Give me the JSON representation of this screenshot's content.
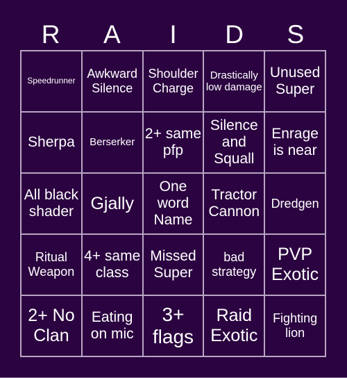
{
  "title": [
    "R",
    "A",
    "I",
    "D",
    "S"
  ],
  "cells": [
    {
      "text": "Speedrunner",
      "size": "s-xs"
    },
    {
      "text": "Awkward Silence",
      "size": "s-md"
    },
    {
      "text": "Shoulder Charge",
      "size": "s-md"
    },
    {
      "text": "Drastically low damage",
      "size": "s-sm"
    },
    {
      "text": "Unused Super",
      "size": "s-lg"
    },
    {
      "text": "Sherpa",
      "size": "s-lg"
    },
    {
      "text": "Berserker",
      "size": "s-sm"
    },
    {
      "text": "2+ same pfp",
      "size": "s-lg"
    },
    {
      "text": "Silence and Squall",
      "size": "s-lg"
    },
    {
      "text": "Enrage is near",
      "size": "s-lg"
    },
    {
      "text": "All black shader",
      "size": "s-lg"
    },
    {
      "text": "Gjally",
      "size": "s-xl"
    },
    {
      "text": "One word Name",
      "size": "s-lg"
    },
    {
      "text": "Tractor Cannon",
      "size": "s-lg"
    },
    {
      "text": "Dredgen",
      "size": "s-md"
    },
    {
      "text": "Ritual Weapon",
      "size": "s-md"
    },
    {
      "text": "4+ same class",
      "size": "s-lg"
    },
    {
      "text": "Missed Super",
      "size": "s-lg"
    },
    {
      "text": "bad strategy",
      "size": "s-md"
    },
    {
      "text": "PVP Exotic",
      "size": "s-xl"
    },
    {
      "text": "2+ No Clan",
      "size": "s-xl"
    },
    {
      "text": "Eating on mic",
      "size": "s-lg"
    },
    {
      "text": "3+ flags",
      "size": "s-xxl"
    },
    {
      "text": "Raid Exotic",
      "size": "s-xl"
    },
    {
      "text": "Fighting lion",
      "size": "s-md"
    }
  ]
}
